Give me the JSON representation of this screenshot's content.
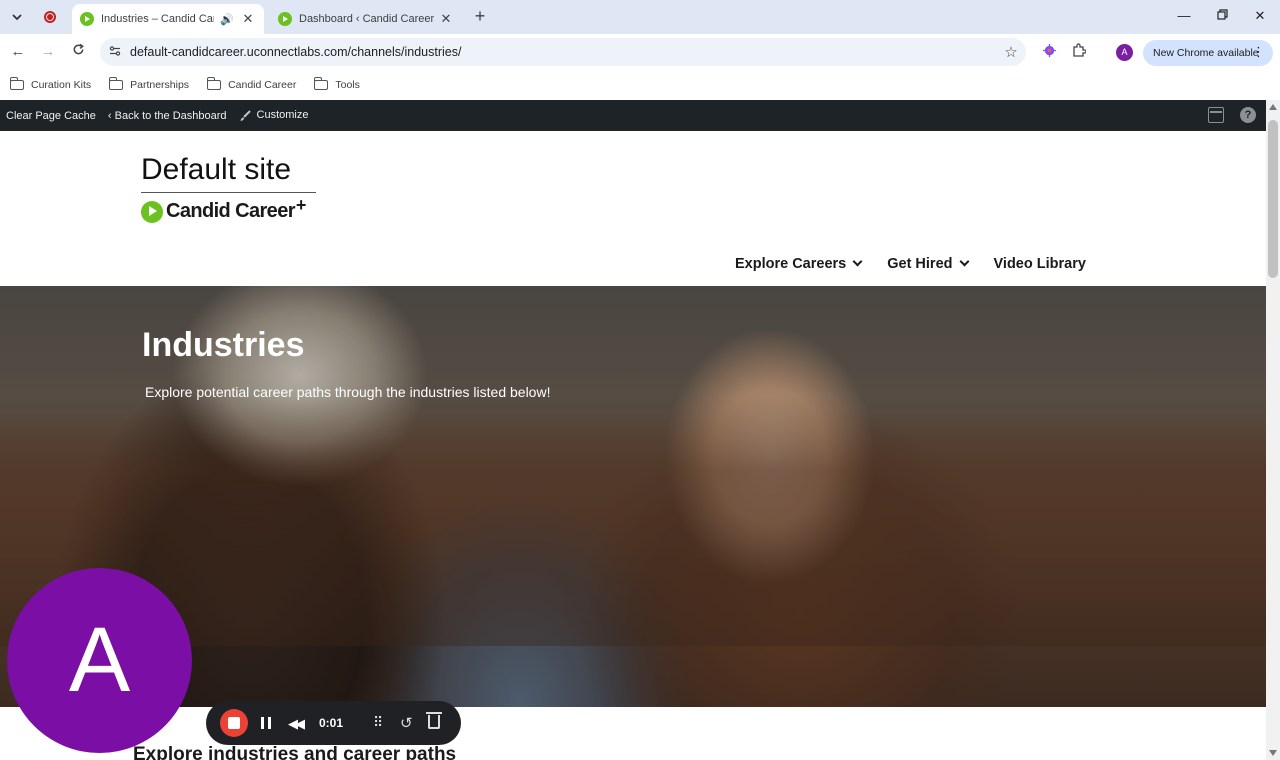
{
  "browser": {
    "tabs": [
      {
        "title": "Industries – Candid Career",
        "active": true,
        "audio": true
      },
      {
        "title": "Dashboard ‹ Candid Career",
        "active": false,
        "audio": false
      }
    ],
    "url": "default-candidcareer.uconnectlabs.com/channels/industries/",
    "profile_initial": "A",
    "update_label": "New Chrome available",
    "bookmarks": [
      "Curation Kits",
      "Partnerships",
      "Candid Career",
      "Tools"
    ]
  },
  "admin_bar": {
    "clear_cache": "Clear Page Cache",
    "back": "‹ Back to the Dashboard",
    "customize": "Customize"
  },
  "site": {
    "title": "Default site",
    "logo_text": "Candid Career",
    "logo_plus": "+",
    "nav": [
      {
        "label": "Explore Careers",
        "has_dropdown": true
      },
      {
        "label": "Get Hired",
        "has_dropdown": true
      },
      {
        "label": "Video Library",
        "has_dropdown": false
      }
    ]
  },
  "hero": {
    "heading": "Industries",
    "subheading": "Explore potential career paths through the industries listed below!"
  },
  "section_heading": "Explore industries and career paths",
  "recorder": {
    "avatar_initial": "A",
    "time": "0:01",
    "avatar_color": "#7a0ea5",
    "stop_color": "#ea4335"
  },
  "colors": {
    "brand_green": "#6ac11f",
    "admin_bar": "#1d2327",
    "tabstrip": "#dfe7f5"
  }
}
